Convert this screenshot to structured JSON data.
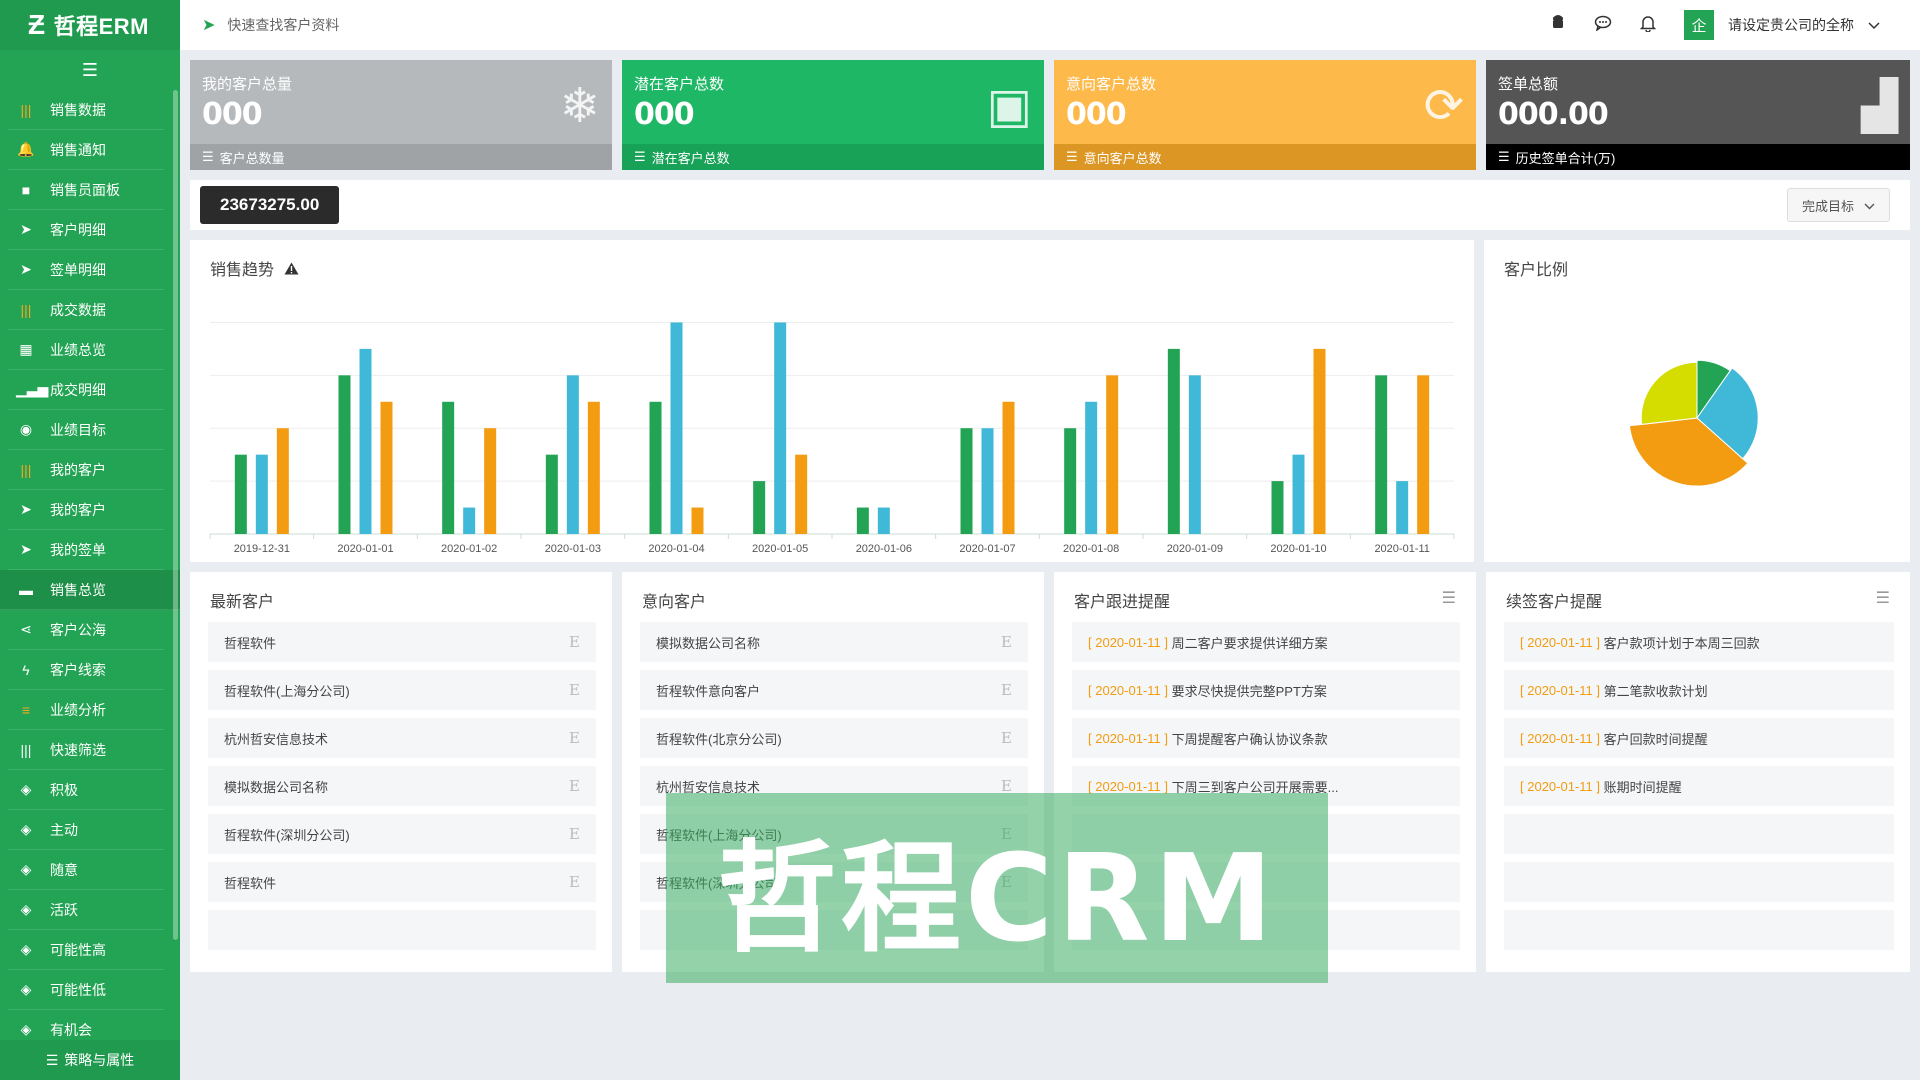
{
  "brand": {
    "logo": "Ƶ",
    "name": "哲程ERM"
  },
  "sidebar": {
    "toggle": "☰",
    "items": [
      {
        "label": "销售数据",
        "icon": "bars-icon",
        "glyph": "|||",
        "orange": true
      },
      {
        "label": "销售通知",
        "icon": "bell-icon",
        "glyph": "🔔"
      },
      {
        "label": "销售员面板",
        "icon": "video-icon",
        "glyph": "■"
      },
      {
        "label": "客户明细",
        "icon": "send-icon",
        "glyph": "➤"
      },
      {
        "label": "签单明细",
        "icon": "plane-icon",
        "glyph": "➤"
      },
      {
        "label": "成交数据",
        "icon": "bars-icon",
        "glyph": "|||",
        "orange": true
      },
      {
        "label": "业绩总览",
        "icon": "grid-icon",
        "glyph": "▦"
      },
      {
        "label": "成交明细",
        "icon": "signal-icon",
        "glyph": "▁▃▅"
      },
      {
        "label": "业绩目标",
        "icon": "target-icon",
        "glyph": "◉"
      },
      {
        "label": "我的客户",
        "icon": "bars-icon",
        "glyph": "|||",
        "orange": true
      },
      {
        "label": "我的客户",
        "icon": "send-icon",
        "glyph": "➤"
      },
      {
        "label": "我的签单",
        "icon": "plane-icon",
        "glyph": "➤"
      },
      {
        "label": "销售总览",
        "icon": "folder-icon",
        "glyph": "▬",
        "active": true
      },
      {
        "label": "客户公海",
        "icon": "share-icon",
        "glyph": "⋖"
      },
      {
        "label": "客户线索",
        "icon": "bolt-icon",
        "glyph": "ϟ"
      },
      {
        "label": "业绩分析",
        "icon": "list-icon",
        "glyph": "≡",
        "orange": true
      },
      {
        "label": "快速筛选",
        "icon": "bars-icon",
        "glyph": "|||"
      },
      {
        "label": "积极",
        "icon": "tag-icon",
        "glyph": "◈"
      },
      {
        "label": "主动",
        "icon": "tag-icon",
        "glyph": "◈"
      },
      {
        "label": "随意",
        "icon": "tag-icon",
        "glyph": "◈"
      },
      {
        "label": "活跃",
        "icon": "tag-icon",
        "glyph": "◈"
      },
      {
        "label": "可能性高",
        "icon": "tag-icon",
        "glyph": "◈"
      },
      {
        "label": "可能性低",
        "icon": "tag-icon",
        "glyph": "◈"
      },
      {
        "label": "有机会",
        "icon": "tag-icon",
        "glyph": "◈"
      }
    ],
    "footer": "策略与属性"
  },
  "topbar": {
    "search_text": "快速查找客户资料",
    "company_badge": "企",
    "company_name": "请设定贵公司的全称"
  },
  "stats": [
    {
      "label": "我的客户总量",
      "value": "000",
      "foot": "客户总数量",
      "color": "#b5b9bc",
      "foot_color": "#9fa3a6",
      "icon": "snowflake-icon",
      "glyph": "❄"
    },
    {
      "label": "潜在客户总数",
      "value": "000",
      "foot": "潜在客户总数",
      "color": "#1db765",
      "foot_color": "#17a257",
      "icon": "contact-card-icon",
      "glyph": "▣"
    },
    {
      "label": "意向客户总数",
      "value": "000",
      "foot": "意向客户总数",
      "color": "#fdb94a",
      "foot_color": "#dc9623",
      "icon": "refresh-icon",
      "glyph": "⟳"
    },
    {
      "label": "签单总额",
      "value": "000.00",
      "foot": "历史签单合计(万)",
      "color": "#555555",
      "foot_color": "#000000",
      "icon": "bar-chart-icon",
      "glyph": "▟"
    }
  ],
  "total": {
    "amount": "23673275.00",
    "goal_button": "完成目标"
  },
  "sales_chart": {
    "title": "销售趋势",
    "chart_data": {
      "type": "bar",
      "categories": [
        "2019-12-31",
        "2020-01-01",
        "2020-01-02",
        "2020-01-03",
        "2020-01-04",
        "2020-01-05",
        "2020-01-06",
        "2020-01-07",
        "2020-01-08",
        "2020-01-09",
        "2020-01-10",
        "2020-01-11"
      ],
      "series": [
        {
          "color": "#22a454",
          "values": [
            3,
            6,
            5,
            3,
            5,
            2,
            1,
            4,
            4,
            7,
            2,
            6
          ]
        },
        {
          "color": "#40b8d8",
          "values": [
            3,
            7,
            1,
            6,
            8,
            8,
            1,
            4,
            5,
            6,
            3,
            2
          ]
        },
        {
          "color": "#f39c12",
          "values": [
            4,
            5,
            4,
            5,
            1,
            3,
            0,
            5,
            6,
            0,
            7,
            6
          ]
        }
      ],
      "ylim": [
        0,
        9
      ],
      "grid": true
    }
  },
  "pie_chart": {
    "title": "客户比例",
    "chart_data": {
      "type": "pie",
      "values": [
        8,
        22,
        30,
        22
      ],
      "colors": [
        "#22a454",
        "#40b8d8",
        "#f39c12",
        "#d4dc00"
      ],
      "start_angle_deg": -90,
      "rose": true,
      "radii_rel": [
        0.85,
        0.9,
        1.0,
        0.82
      ]
    }
  },
  "lists": {
    "newest": {
      "title": "最新客户",
      "rows": [
        "哲程软件",
        "哲程软件(上海分公司)",
        "杭州哲安信息技术",
        "模拟数据公司名称",
        "哲程软件(深圳分公司)",
        "哲程软件",
        ""
      ]
    },
    "intent": {
      "title": "意向客户",
      "rows": [
        "模拟数据公司名称",
        "哲程软件意向客户",
        "哲程软件(北京分公司)",
        "杭州哲安信息技术",
        "哲程软件(上海分公司)",
        "哲程软件(深圳分公司)",
        ""
      ]
    },
    "followup": {
      "title": "客户跟进提醒",
      "rows": [
        {
          "date": "2020-01-11",
          "text": "周二客户要求提供详细方案"
        },
        {
          "date": "2020-01-11",
          "text": "要求尽快提供完整PPT方案"
        },
        {
          "date": "2020-01-11",
          "text": "下周提醒客户确认协议条款"
        },
        {
          "date": "2020-01-11",
          "text": "下周三到客户公司开展需要..."
        },
        {
          "date": "",
          "text": ""
        },
        {
          "date": "",
          "text": ""
        },
        {
          "date": "",
          "text": ""
        }
      ]
    },
    "renew": {
      "title": "续签客户提醒",
      "rows": [
        {
          "date": "2020-01-11",
          "text": "客户款项计划于本周三回款"
        },
        {
          "date": "2020-01-11",
          "text": "第二笔款收款计划"
        },
        {
          "date": "2020-01-11",
          "text": "客户回款时间提醒"
        },
        {
          "date": "2020-01-11",
          "text": "账期时间提醒"
        },
        {
          "date": "",
          "text": ""
        },
        {
          "date": "",
          "text": ""
        },
        {
          "date": "",
          "text": ""
        }
      ]
    }
  },
  "watermark": "哲程CRM"
}
